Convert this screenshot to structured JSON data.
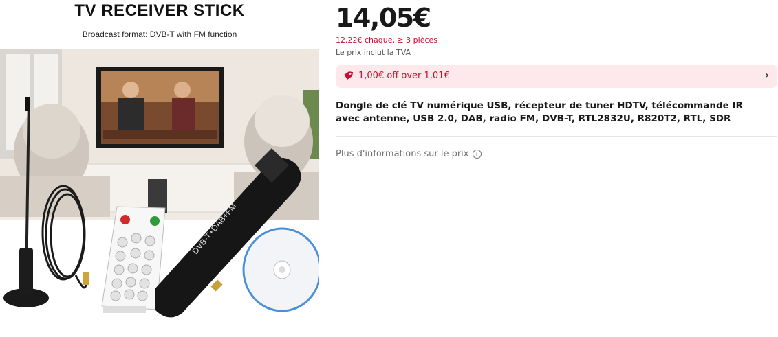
{
  "image": {
    "banner_title": "TV RECEIVER STICK",
    "banner_subtitle": "Broadcast format: DVB-T with FM function",
    "stick_label": "DVB-T+DAB+FM"
  },
  "price": {
    "main": "14,05€",
    "bulk": "12,22€ chaque, ≥ 3 pièces",
    "vat": "Le prix inclut la TVA"
  },
  "coupon": {
    "text": "1,00€ off over 1,01€",
    "icon": "tag-icon",
    "chevron": "›"
  },
  "product": {
    "title": "Dongle de clé TV numérique USB, récepteur de tuner HDTV, télécommande IR avec antenne, USB 2.0, DAB, radio FM, DVB-T, RTL2832U, R820T2, RTL, SDR"
  },
  "more_info": {
    "label": "Plus d'informations sur le prix",
    "icon_glyph": "i"
  },
  "colors": {
    "accent_red": "#c8102e",
    "coupon_bg": "#fde9ec"
  }
}
